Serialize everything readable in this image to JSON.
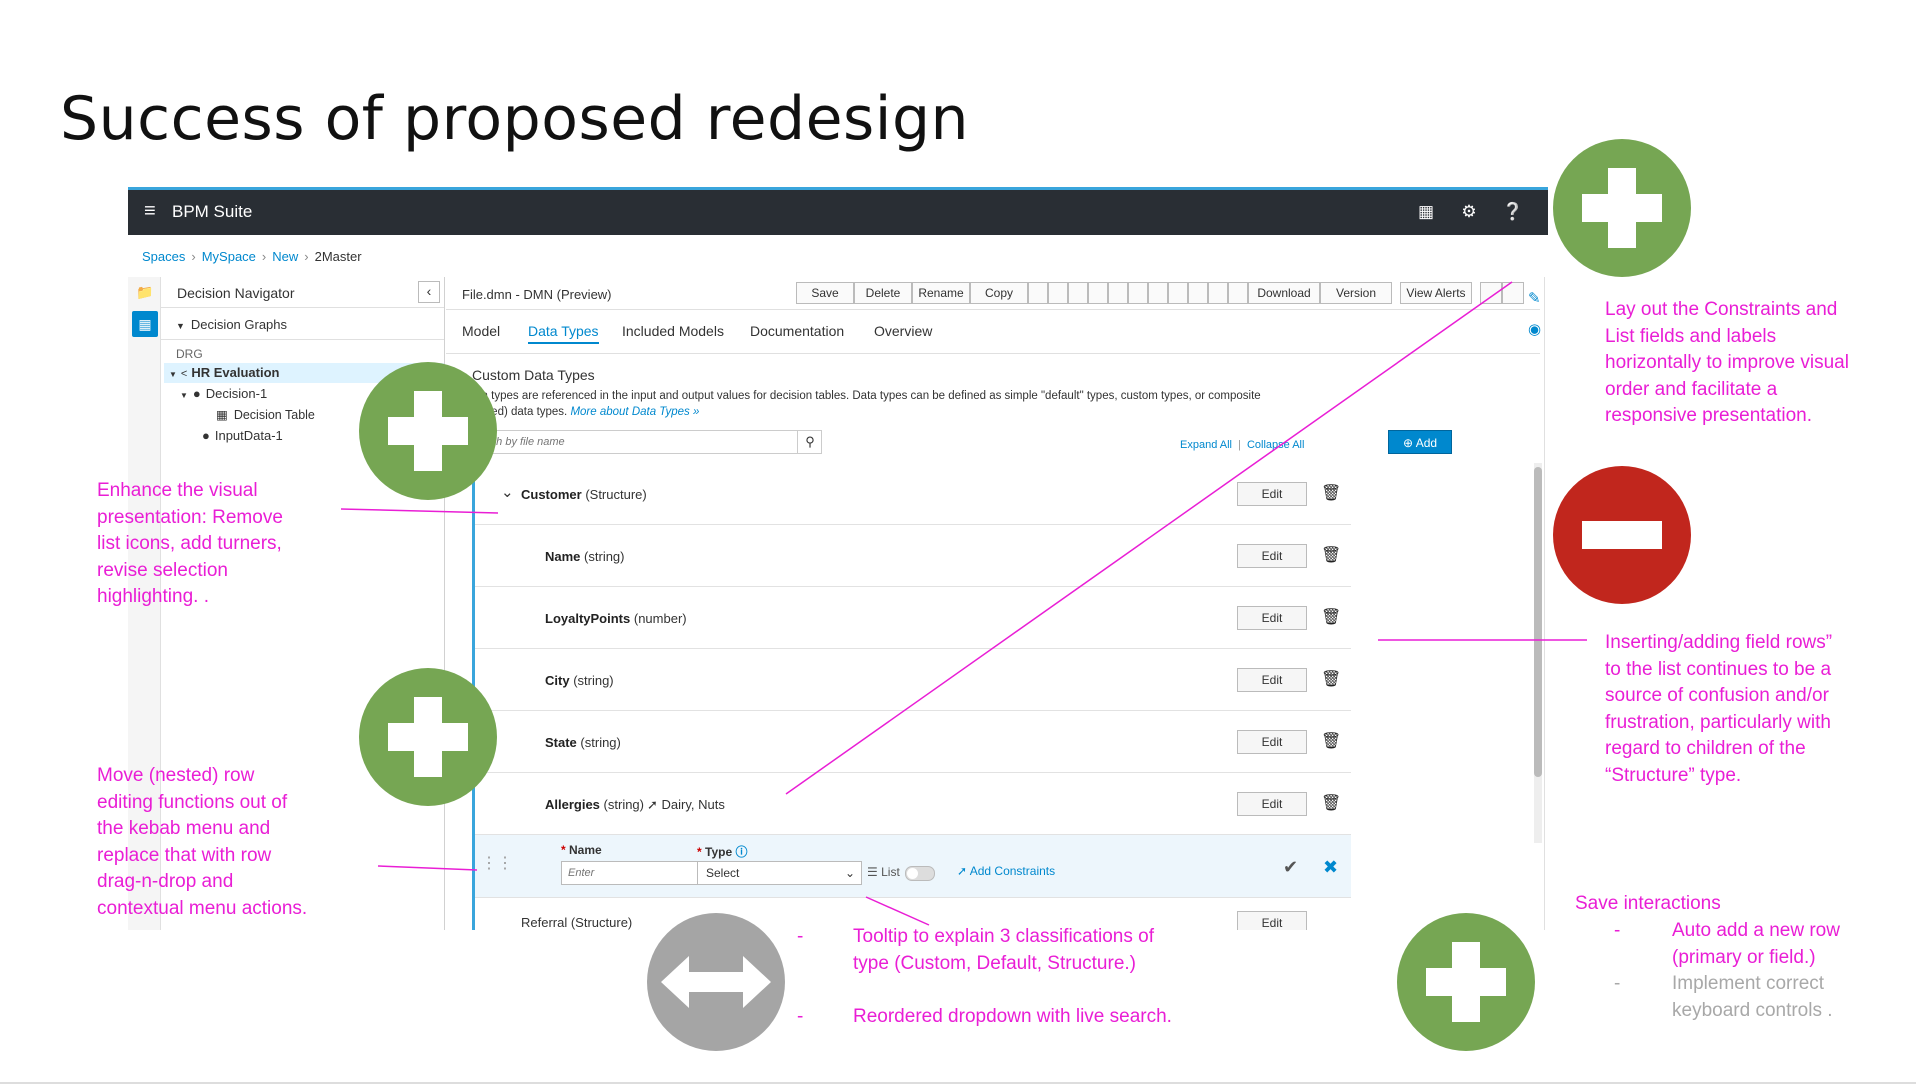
{
  "slide": {
    "title": "Success of proposed redesign"
  },
  "app": {
    "brand": "BPM Suite",
    "top_icons": [
      "grid-icon",
      "gear-icon",
      "help-icon",
      "user-icon"
    ],
    "accent": "#39a5dc",
    "breadcrumb": [
      "Spaces",
      "MySpace",
      "New",
      "2Master"
    ]
  },
  "navigator": {
    "title": "Decision Navigator",
    "graphs_label": "Decision Graphs",
    "drg_label": "DRG",
    "tree": {
      "root": "HR Evaluation",
      "decision": "Decision-1",
      "table": "Decision Table",
      "input": "InputData-1"
    }
  },
  "editor": {
    "file_title": "File.dmn - DMN (Preview)",
    "toolbar": [
      "Save",
      "Delete",
      "Rename",
      "Copy",
      "Download",
      "Version",
      "View Alerts"
    ],
    "tabs": [
      "Model",
      "Data Types",
      "Included Models",
      "Documentation",
      "Overview"
    ],
    "active_tab": "Data Types",
    "section_title": "Custom Data Types",
    "desc_line1": "ata types are referenced in the input and output values for decision tables. Data types can be defined as simple \"default\" types, custom types, or composite",
    "desc_line2": "ctured) data types.",
    "desc_more": "More about Data Types »",
    "search_placeholder": "rch by file name",
    "expand_all": "Expand All",
    "collapse_all": "Collapse All",
    "link_sep": "|",
    "add_label": "Add",
    "edit_label": "Edit",
    "rows": [
      {
        "name": "Customer",
        "type": "(Structure)"
      },
      {
        "name": "Name",
        "type": "(string)"
      },
      {
        "name": "LoyaltyPoints",
        "type": "(number)"
      },
      {
        "name": "City",
        "type": "(string)"
      },
      {
        "name": "State",
        "type": "(string)"
      },
      {
        "name": "Allergies",
        "type": "(string)",
        "constraint": "Dairy, Nuts"
      }
    ],
    "form": {
      "name_label": "Name",
      "name_placeholder": "Enter",
      "type_label": "Type",
      "type_value": "Select",
      "list_label": "List",
      "list_on": false,
      "add_constraints": "Add Constraints"
    },
    "partial_row": "Referral (Structure)"
  },
  "annotations": {
    "visual": [
      "Enhance the visual",
      "presentation: Remove",
      "list icons, add turners,",
      "revise selection",
      "highlighting. ."
    ],
    "nested": [
      "Move (nested) row",
      "editing functions out of",
      "the kebab menu and",
      "replace that with row",
      "drag-n-drop and",
      "contextual menu actions."
    ],
    "layout": [
      "Lay out the Constraints and",
      "List fields and labels",
      "horizontally to improve visual",
      "order and facilitate a",
      "responsive presentation."
    ],
    "inserting": [
      "Inserting/adding  field rows”",
      "to the list continues to be a",
      "source of confusion and/or",
      "frustration, particularly with",
      "regard to children of the",
      "“Structure” type."
    ],
    "tooltip": [
      "Tooltip to explain 3 classifications of",
      "type (Custom, Default, Structure.)"
    ],
    "dropdown": "Reordered dropdown with live search.",
    "bullet": "-",
    "save_title": "Save interactions",
    "save_items": [
      {
        "text": [
          "Auto add a new row",
          "(primary or field.)"
        ],
        "active": true
      },
      {
        "text": [
          "Implement correct",
          "keyboard controls ."
        ],
        "active": false
      }
    ]
  },
  "colors": {
    "positive": "#76a653",
    "negative": "#c1261d",
    "neutral": "#a5a5a5",
    "annotation": "#e91ed5"
  }
}
